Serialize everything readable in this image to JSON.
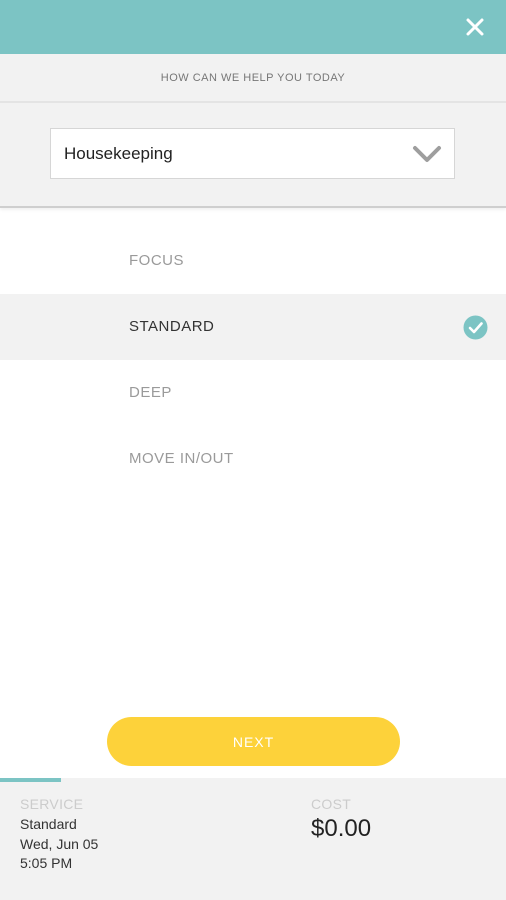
{
  "header": {
    "close_icon": "close-icon",
    "color": "#7cc4c4"
  },
  "prompt": {
    "text": "HOW CAN WE HELP YOU TODAY"
  },
  "service_select": {
    "value": "Housekeeping",
    "icon": "chevron-down-icon"
  },
  "options": [
    {
      "label": "FOCUS",
      "selected": false
    },
    {
      "label": "STANDARD",
      "selected": true
    },
    {
      "label": "DEEP",
      "selected": false
    },
    {
      "label": "MOVE IN/OUT",
      "selected": false
    }
  ],
  "next_button": {
    "label": "NEXT",
    "color": "#fdd23a"
  },
  "progress": {
    "fraction": 0.12
  },
  "summary": {
    "service_label": "SERVICE",
    "service_name": "Standard",
    "date": "Wed, Jun 05",
    "time": "5:05 PM",
    "cost_label": "COST",
    "cost_value": "$0.00"
  },
  "colors": {
    "accent": "#7cc4c4",
    "button": "#fdd23a",
    "panel_bg": "#f2f2f2"
  }
}
